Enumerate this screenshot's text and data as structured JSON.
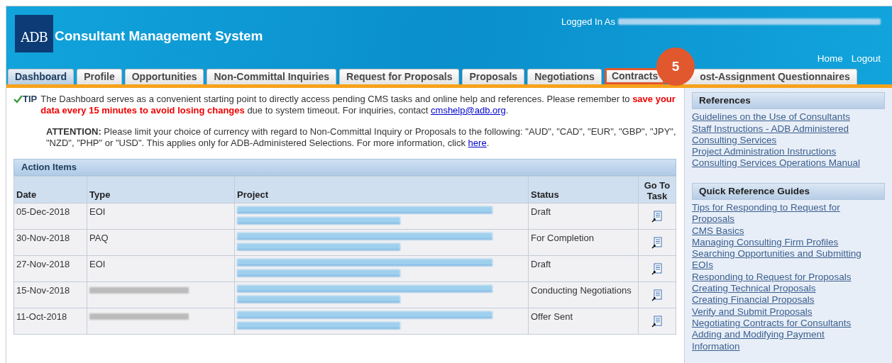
{
  "header": {
    "logo": "ADB",
    "title": "Consultant Management System",
    "logged_in_label": "Logged In As",
    "user_redacted": true,
    "links": [
      "Home",
      "Logout"
    ]
  },
  "tabs": [
    {
      "label": "Dashboard",
      "selected": true,
      "highlighted": false
    },
    {
      "label": "Profile",
      "selected": false,
      "highlighted": false
    },
    {
      "label": "Opportunities",
      "selected": false,
      "highlighted": false
    },
    {
      "label": "Non-Committal Inquiries",
      "selected": false,
      "highlighted": false
    },
    {
      "label": "Request for Proposals",
      "selected": false,
      "highlighted": false
    },
    {
      "label": "Proposals",
      "selected": false,
      "highlighted": false
    },
    {
      "label": "Negotiations",
      "selected": false,
      "highlighted": false
    },
    {
      "label": "Contracts",
      "selected": false,
      "highlighted": true
    },
    {
      "label": "ost-Assignment Questionnaires",
      "selected": false,
      "highlighted": false
    }
  ],
  "callout": {
    "number": "5"
  },
  "tip": {
    "label": "TIP",
    "text_before": "The Dashboard serves as a convenient starting point to directly access pending CMS tasks and online help and references. Please remember to",
    "warning": "save your data every 15 minutes to avoid losing changes",
    "text_after": "due to system timeout. For inquiries, contact",
    "email": "cmshelp@adb.org",
    "end": "."
  },
  "attention": {
    "label": "ATTENTION:",
    "text": "Please limit your choice of currency with regard to Non-Committal Inquiry or Proposals to the following: \"AUD\", \"CAD\", \"EUR\", \"GBP\", \"JPY\", \"NZD\", \"PHP\" or \"USD\". This applies only for ADB-Administered Selections. For more information, click",
    "link": "here",
    "end": "."
  },
  "action_items": {
    "title": "Action Items",
    "columns": [
      "Date",
      "Type",
      "Project",
      "Status",
      "Go To Task"
    ],
    "rows": [
      {
        "date": "05-Dec-2018",
        "type": {
          "kind": "text",
          "text": "EOI"
        },
        "project": {
          "kind": "redacted"
        },
        "status": "Draft"
      },
      {
        "date": "30-Nov-2018",
        "type": {
          "kind": "text",
          "text": "PAQ"
        },
        "project": {
          "kind": "redacted"
        },
        "status": "For Completion"
      },
      {
        "date": "27-Nov-2018",
        "type": {
          "kind": "text",
          "text": "EOI"
        },
        "project": {
          "kind": "redacted"
        },
        "status": "Draft"
      },
      {
        "date": "15-Nov-2018",
        "type": {
          "kind": "redacted"
        },
        "project": {
          "kind": "redacted"
        },
        "status": "Conducting Negotiations"
      },
      {
        "date": "11-Oct-2018",
        "type": {
          "kind": "redacted"
        },
        "project": {
          "kind": "redacted"
        },
        "status": "Offer Sent"
      }
    ]
  },
  "sidebar": [
    {
      "title": "References",
      "links": [
        "Guidelines on the Use of Consultants",
        "Staff Instructions - ADB Administered Consulting Services",
        "Project Administration Instructions",
        "Consulting Services Operations Manual"
      ]
    },
    {
      "title": "Quick Reference Guides",
      "links": [
        "Tips for Responding to Request for Proposals",
        "CMS Basics",
        "Managing Consulting Firm Profiles",
        "Searching Opportunities and Submitting EOIs",
        "Responding to Request for Proposals",
        "Creating Technical Proposals",
        "Creating Financial Proposals",
        "Verify and Submit Proposals",
        "Negotiating Contracts for Consultants",
        "Adding and Modifying Payment Information"
      ]
    }
  ]
}
